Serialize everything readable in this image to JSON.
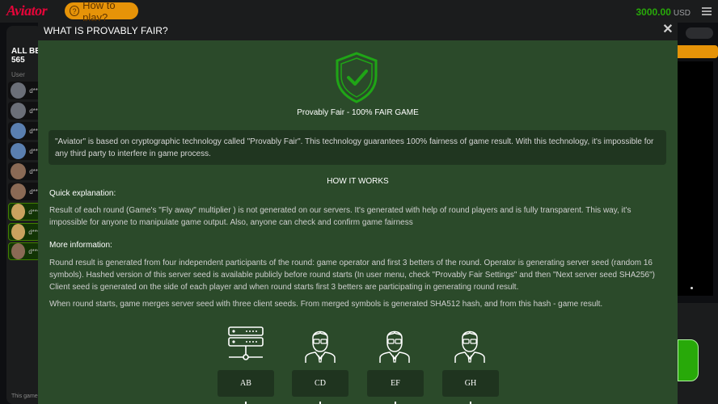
{
  "topbar": {
    "logo": "Aviator",
    "how_to_play": "How to play?",
    "balance": "3000.00",
    "currency": "USD"
  },
  "left_panel": {
    "all_bets_label": "ALL BETS",
    "all_bets_count": "565",
    "user_col": "User",
    "rows": [
      {
        "name": "d***",
        "avatar_color": "#6b6f78",
        "win": false
      },
      {
        "name": "d***",
        "avatar_color": "#6b6f78",
        "win": false
      },
      {
        "name": "d***",
        "avatar_color": "#5a7fb0",
        "win": false
      },
      {
        "name": "d***",
        "avatar_color": "#5a7fb0",
        "win": false
      },
      {
        "name": "d***",
        "avatar_color": "#8a6a55",
        "win": false
      },
      {
        "name": "d***",
        "avatar_color": "#8a6a55",
        "win": false
      },
      {
        "name": "d***",
        "avatar_color": "#c9a25f",
        "win": true
      },
      {
        "name": "d***",
        "avatar_color": "#c9a25f",
        "win": true
      },
      {
        "name": "d***",
        "avatar_color": "#8a6a55",
        "win": true
      }
    ],
    "footer": "This game"
  },
  "modal": {
    "title": "WHAT IS PROVABLY FAIR?",
    "close_icon": "close-icon",
    "tagline": "Provably Fair - 100% FAIR GAME",
    "intro": "\"Aviator\" is based on cryptographic technology called \"Provably Fair\". This technology guarantees 100% fairness of game result. With this technology, it's impossible for any third party to interfere in game process.",
    "how_it_works": "HOW IT WORKS",
    "quick_heading": "Quick explanation:",
    "quick_text": "Result of each round (Game's \"Fly away\" multiplier ) is not generated on our servers. It's generated with help of round players and is fully transparent. This way, it's impossible for anyone to manipulate game output. Also, anyone can check and confirm game fairness",
    "more_heading": "More information:",
    "more_text_1": "Round result is generated from four independent participants of the round: game operator and first 3 betters of the round. Operator is generating server seed (random 16 symbols). Hashed version of this server seed is available publicly before round starts (In user menu, check \"Provably Fair Settings\" and then \"Next server seed SHA256\") Client seed is generated on the side of each player and when round starts first 3 betters are participating in generating round result.",
    "more_text_2": "When round starts, game merges server seed with three client seeds. From merged symbols is generated SHA512 hash, and from this hash - game result.",
    "seeds": [
      {
        "label": "AB",
        "icon": "server-icon"
      },
      {
        "label": "CD",
        "icon": "player-icon"
      },
      {
        "label": "EF",
        "icon": "player-icon"
      },
      {
        "label": "GH",
        "icon": "player-icon"
      }
    ],
    "shield_color": "#1fa516"
  }
}
